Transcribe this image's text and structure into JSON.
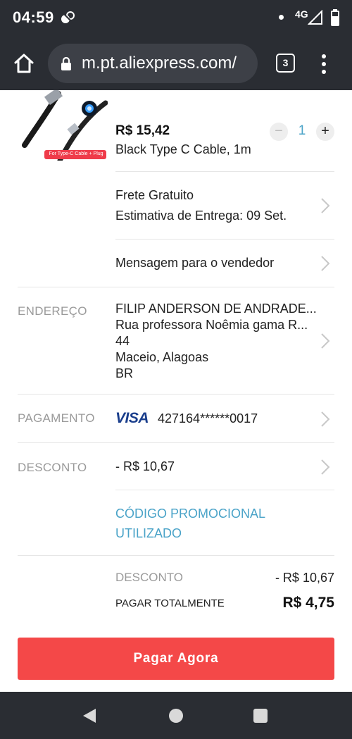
{
  "status_bar": {
    "time": "04:59",
    "network": "4G"
  },
  "browser": {
    "url": "m.pt.aliexpress.com/",
    "tab_count": "3"
  },
  "product": {
    "image_caption": "For Type-C Cable + Plug",
    "price": "R$ 15,42",
    "variant": "Black Type C Cable,  1m",
    "quantity": "1",
    "qty_minus": "−",
    "qty_plus": "+"
  },
  "shipping": {
    "line1": "Frete Gratuito",
    "line2": "Estimativa de Entrega: 09 Set."
  },
  "message": {
    "label": "Mensagem para o vendedor"
  },
  "address": {
    "label": "ENDEREÇO",
    "name": "FILIP ANDERSON DE ANDRADE...",
    "street": "Rua professora Noêmia gama R...",
    "number": "44",
    "city": "Maceio, Alagoas",
    "country": "BR"
  },
  "payment": {
    "label": "PAGAMENTO",
    "brand": "VISA",
    "card": "427164******0017"
  },
  "discount": {
    "label": "DESCONTO",
    "value": "- R$ 10,67",
    "promo_line1": "CÓDIGO PROMOCIONAL",
    "promo_line2": "UTILIZADO"
  },
  "summary": {
    "discount_label": "DESCONTO",
    "discount_value": "- R$ 10,67",
    "total_label": "PAGAR TOTALMENTE",
    "total_value": "R$ 4,75"
  },
  "pay_button": "Pagar Agora",
  "colors": {
    "accent": "#f44848",
    "link": "#4aa3c8",
    "visa": "#1a3e8c",
    "chrome": "#2a2d33"
  }
}
